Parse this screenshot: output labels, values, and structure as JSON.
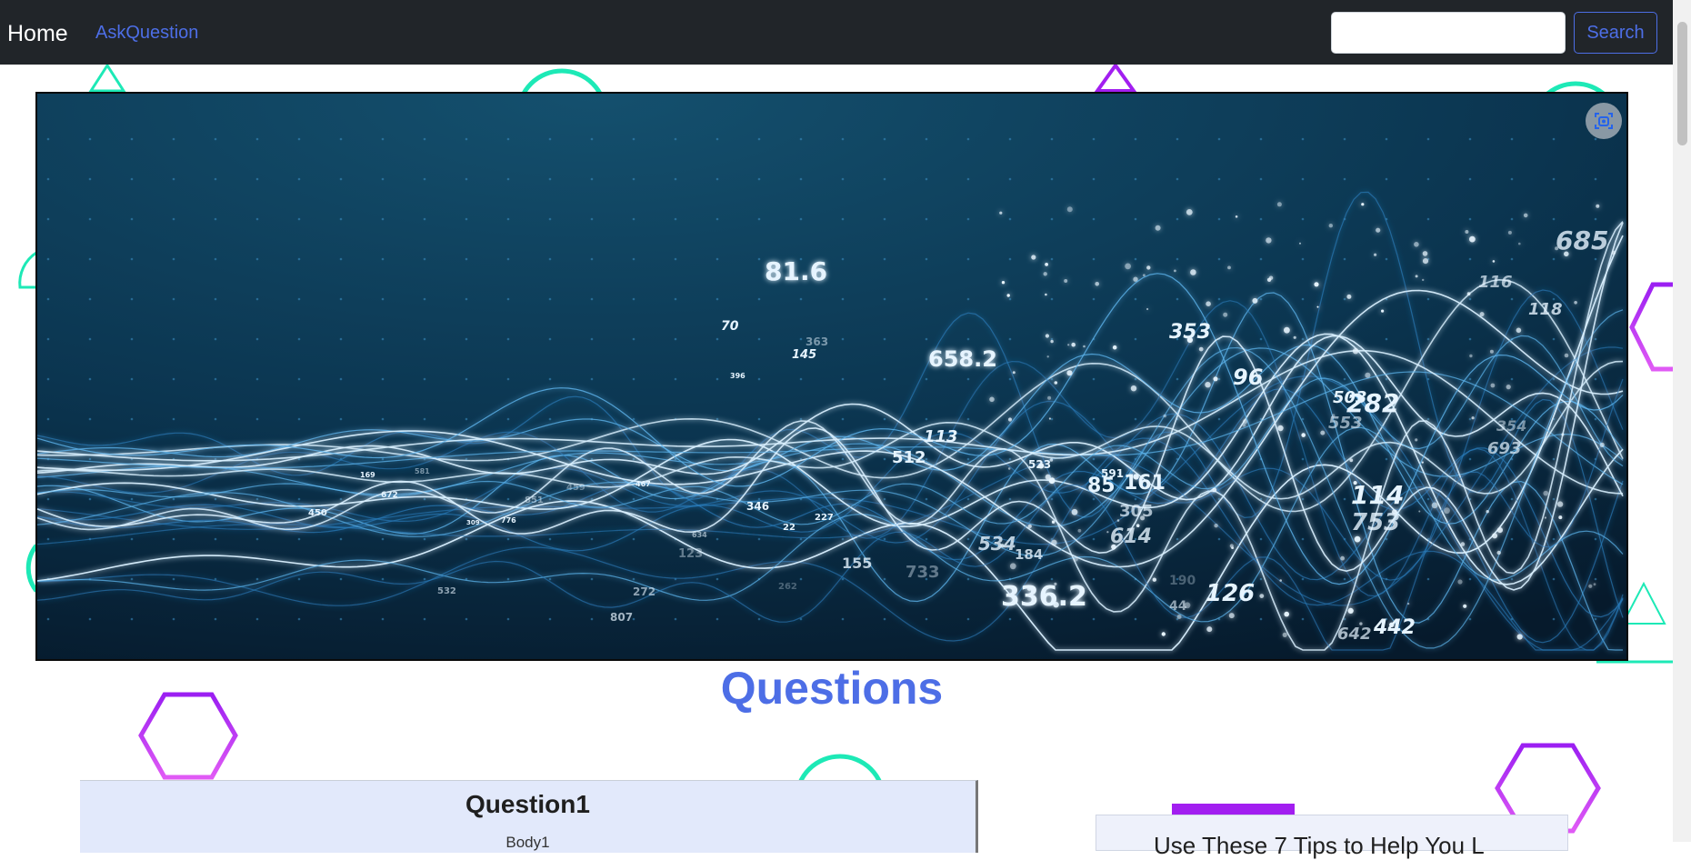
{
  "navbar": {
    "brand": "Home",
    "links": [
      {
        "label": "AskQuestion"
      }
    ],
    "search": {
      "placeholder": "",
      "value": "",
      "button_label": "Search"
    }
  },
  "hero": {
    "numbers": [
      "81.6",
      "658.2",
      "353",
      "96",
      "282",
      "503",
      "553",
      "114",
      "753",
      "336.2",
      "126",
      "442",
      "642",
      "685",
      "116",
      "118",
      "693",
      "354",
      "113",
      "512",
      "70",
      "145",
      "363",
      "396",
      "523",
      "591",
      "85",
      "161",
      "305",
      "614",
      "534",
      "184",
      "155",
      "733",
      "346",
      "227",
      "22",
      "123",
      "169",
      "672",
      "450",
      "581",
      "851",
      "459",
      "467",
      "309",
      "776",
      "634",
      "532",
      "272",
      "807",
      "262",
      "44",
      "190"
    ]
  },
  "main": {
    "heading": "Questions",
    "questions": [
      {
        "title": "Question1",
        "body": "Body1"
      }
    ],
    "side_card": {
      "title": "Use These 7 Tips to Help You L"
    }
  },
  "colors": {
    "accent": "#4d6ee6",
    "navbar": "#212529",
    "purple": "#a21ef0",
    "teal": "#1de9b6"
  }
}
